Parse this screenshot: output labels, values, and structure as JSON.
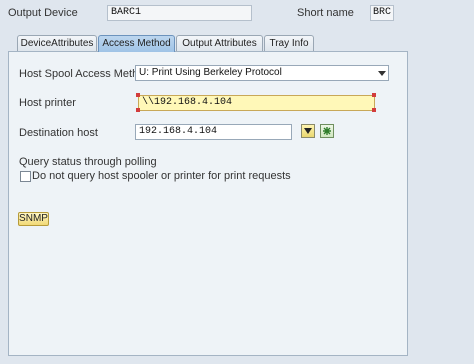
{
  "header": {
    "output_device_label": "Output Device",
    "output_device_value": "BARC1",
    "short_name_label": "Short name",
    "short_name_value": "BRC"
  },
  "tabs": [
    {
      "label": "DeviceAttributes"
    },
    {
      "label": "Access Method"
    },
    {
      "label": "Output Attributes"
    },
    {
      "label": "Tray Info"
    }
  ],
  "form": {
    "access_method_label": "Host Spool Access Method",
    "access_method_value": "U: Print Using Berkeley Protocol",
    "host_printer_label": "Host printer",
    "host_printer_value": "\\\\192.168.4.104",
    "destination_host_label": "Destination host",
    "destination_host_value": "192.168.4.104",
    "query_status_label": "Query status through polling",
    "no_query_label": "Do not query host spooler or printer for print requests",
    "snmp_button": "SNMP"
  },
  "colors": {
    "background": "#dfe6ee",
    "active_tab": "#a8c9ea",
    "highlight_field": "#fff8b8",
    "button": "#f1d977"
  }
}
